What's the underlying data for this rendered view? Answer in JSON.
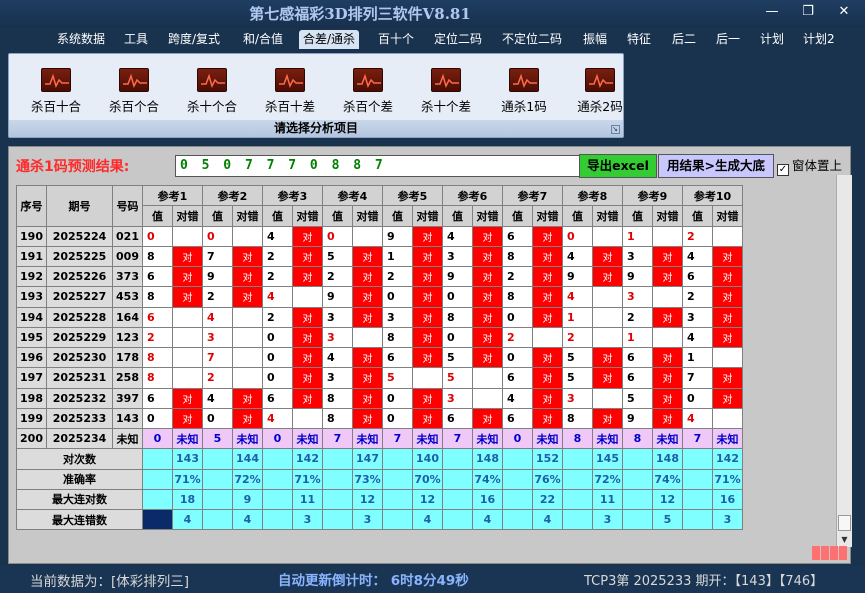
{
  "window": {
    "title": "第七感福彩3D排列三软件V8.81",
    "minimize": "—",
    "restore": "❐",
    "close": "✕"
  },
  "menu": [
    "系统数据",
    "工具",
    "跨度/复式",
    "和/合值",
    "合差/通杀",
    "百十个",
    "定位二码",
    "不定位二码",
    "振幅",
    "特征",
    "后二",
    "后一",
    "计划",
    "计划2"
  ],
  "ribbon": {
    "buttons": [
      "杀百十合",
      "杀百个合",
      "杀十个合",
      "杀百十差",
      "杀百个差",
      "杀十个差",
      "通杀1码",
      "通杀2码"
    ],
    "caption": "请选择分析项目",
    "icon": "chart-icon"
  },
  "panel": {
    "result_label": "通杀1码预测结果:",
    "result_value": "0 5 0 7 7 7 0 8 8 7",
    "export_button": "导出excel",
    "generate_button": "用结果>生成大底",
    "on_top_label": "窗体置上",
    "on_top_checked": true
  },
  "table": {
    "header_seq": "序号",
    "header_period": "期号",
    "header_number": "号码",
    "refs": [
      "参考1",
      "参考2",
      "参考3",
      "参考4",
      "参考5",
      "参考6",
      "参考7",
      "参考8",
      "参考9",
      "参考10"
    ],
    "sub_value": "值",
    "sub_check": "对错",
    "hit_text": "对",
    "rows": [
      {
        "seq": "190",
        "period": "2025224",
        "num": "021",
        "vals": [
          "0",
          "0",
          "4",
          "0",
          "9",
          "4",
          "6",
          "0",
          "1",
          "2"
        ],
        "hits": [
          false,
          false,
          true,
          false,
          true,
          true,
          true,
          false,
          false,
          false
        ],
        "red": [
          true,
          true,
          false,
          true,
          false,
          false,
          false,
          true,
          true,
          true
        ]
      },
      {
        "seq": "191",
        "period": "2025225",
        "num": "009",
        "vals": [
          "8",
          "7",
          "2",
          "5",
          "1",
          "3",
          "8",
          "4",
          "3",
          "4"
        ],
        "hits": [
          true,
          true,
          true,
          true,
          true,
          true,
          true,
          true,
          true,
          true
        ],
        "red": [
          false,
          false,
          false,
          false,
          false,
          false,
          false,
          false,
          false,
          false
        ]
      },
      {
        "seq": "192",
        "period": "2025226",
        "num": "373",
        "vals": [
          "6",
          "9",
          "2",
          "2",
          "2",
          "9",
          "2",
          "9",
          "9",
          "6"
        ],
        "hits": [
          true,
          true,
          true,
          true,
          true,
          true,
          true,
          true,
          true,
          true
        ],
        "red": [
          false,
          false,
          false,
          false,
          false,
          false,
          false,
          false,
          false,
          false
        ]
      },
      {
        "seq": "193",
        "period": "2025227",
        "num": "453",
        "vals": [
          "8",
          "2",
          "4",
          "9",
          "0",
          "0",
          "8",
          "4",
          "3",
          "2"
        ],
        "hits": [
          true,
          true,
          false,
          true,
          true,
          true,
          true,
          false,
          false,
          true
        ],
        "red": [
          false,
          false,
          true,
          false,
          false,
          false,
          false,
          true,
          true,
          false
        ]
      },
      {
        "seq": "194",
        "period": "2025228",
        "num": "164",
        "vals": [
          "6",
          "4",
          "2",
          "3",
          "3",
          "8",
          "0",
          "1",
          "2",
          "3"
        ],
        "hits": [
          false,
          false,
          true,
          true,
          true,
          true,
          true,
          false,
          true,
          true
        ],
        "red": [
          true,
          true,
          false,
          false,
          false,
          false,
          false,
          true,
          false,
          false
        ]
      },
      {
        "seq": "195",
        "period": "2025229",
        "num": "123",
        "vals": [
          "2",
          "3",
          "0",
          "3",
          "8",
          "0",
          "2",
          "2",
          "1",
          "4"
        ],
        "hits": [
          false,
          false,
          true,
          false,
          true,
          true,
          false,
          false,
          false,
          true
        ],
        "red": [
          true,
          true,
          false,
          true,
          false,
          false,
          true,
          true,
          true,
          false
        ]
      },
      {
        "seq": "196",
        "period": "2025230",
        "num": "178",
        "vals": [
          "8",
          "7",
          "0",
          "4",
          "6",
          "5",
          "0",
          "5",
          "6",
          "1"
        ],
        "hits": [
          false,
          false,
          true,
          true,
          true,
          true,
          true,
          true,
          true,
          false
        ],
        "red": [
          true,
          true,
          false,
          false,
          false,
          false,
          false,
          false,
          false,
          false
        ]
      },
      {
        "seq": "197",
        "period": "2025231",
        "num": "258",
        "vals": [
          "8",
          "2",
          "0",
          "3",
          "5",
          "5",
          "6",
          "5",
          "6",
          "7"
        ],
        "hits": [
          false,
          false,
          true,
          true,
          false,
          false,
          true,
          true,
          true,
          true
        ],
        "red": [
          true,
          true,
          false,
          false,
          true,
          true,
          false,
          false,
          false,
          false
        ]
      },
      {
        "seq": "198",
        "period": "2025232",
        "num": "397",
        "vals": [
          "6",
          "4",
          "6",
          "8",
          "0",
          "3",
          "4",
          "3",
          "5",
          "0"
        ],
        "hits": [
          true,
          true,
          true,
          true,
          true,
          false,
          true,
          false,
          true,
          true
        ],
        "red": [
          false,
          false,
          false,
          false,
          false,
          true,
          false,
          true,
          false,
          false
        ]
      },
      {
        "seq": "199",
        "period": "2025233",
        "num": "143",
        "vals": [
          "0",
          "0",
          "4",
          "8",
          "0",
          "6",
          "6",
          "8",
          "9",
          "4"
        ],
        "hits": [
          true,
          true,
          false,
          true,
          true,
          true,
          true,
          true,
          true,
          false
        ],
        "red": [
          false,
          false,
          true,
          false,
          false,
          false,
          false,
          false,
          false,
          true
        ]
      }
    ],
    "prediction": {
      "seq": "200",
      "period": "2025234",
      "num": "未知",
      "vals": [
        "0",
        "5",
        "0",
        "7",
        "7",
        "7",
        "0",
        "8",
        "8",
        "7"
      ],
      "unknown": "未知"
    },
    "stats": [
      {
        "label": "对次数",
        "values": [
          "143",
          "144",
          "142",
          "147",
          "140",
          "148",
          "152",
          "145",
          "148",
          "142"
        ]
      },
      {
        "label": "准确率",
        "values": [
          "71%",
          "72%",
          "71%",
          "73%",
          "70%",
          "74%",
          "76%",
          "72%",
          "74%",
          "71%"
        ]
      },
      {
        "label": "最大连对数",
        "values": [
          "18",
          "9",
          "11",
          "12",
          "12",
          "16",
          "22",
          "11",
          "12",
          "16"
        ]
      },
      {
        "label": "最大连错数",
        "values": [
          "4",
          "4",
          "3",
          "3",
          "4",
          "4",
          "4",
          "3",
          "5",
          "3"
        ]
      }
    ]
  },
  "status": {
    "current_data": "当前数据为：[体彩排列三]",
    "countdown": "自动更新倒计时：  6时8分49秒",
    "draw_info": "TCP3第 2025233 期开：【143】【746】"
  }
}
